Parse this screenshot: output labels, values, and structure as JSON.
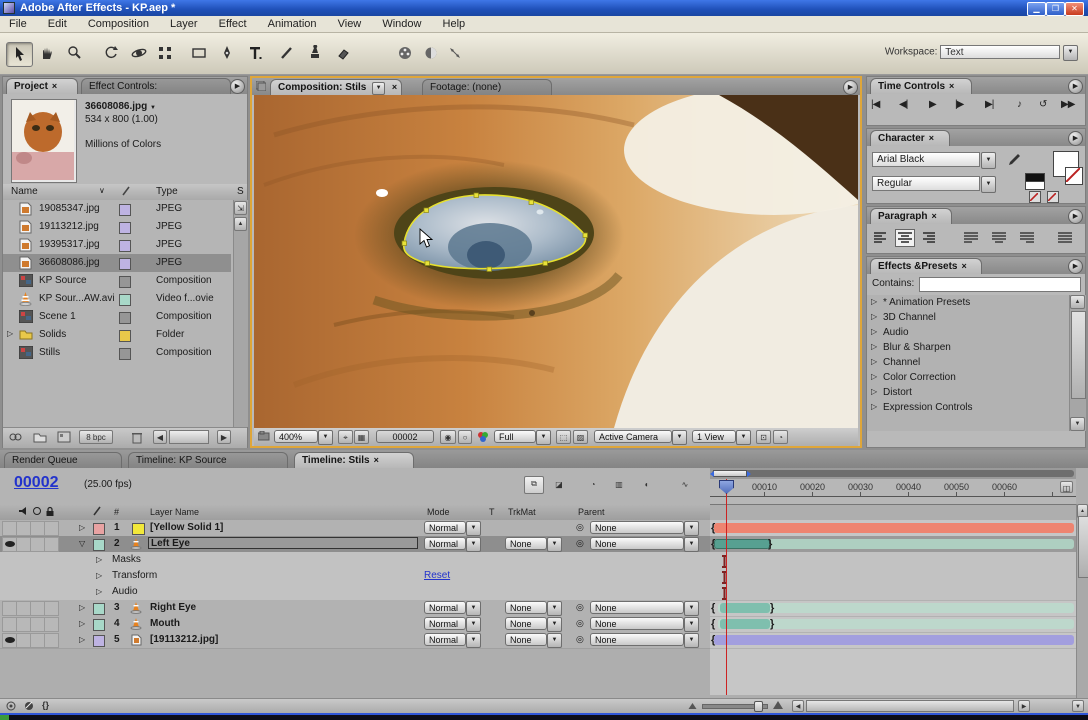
{
  "window": {
    "title": "Adobe After Effects - KP.aep *"
  },
  "menu": [
    "File",
    "Edit",
    "Composition",
    "Layer",
    "Effect",
    "Animation",
    "View",
    "Window",
    "Help"
  ],
  "toolbar": {
    "workspace_label": "Workspace:",
    "workspace_value": "Text"
  },
  "icons": {
    "dropdown": "▼",
    "close": "×",
    "panel_menu": "▶",
    "overflow": "▶",
    "twirl_closed": "▷",
    "twirl_open": "▽",
    "sort": "∨",
    "go_start": "|◀",
    "step_back": "◀|",
    "play": "▶",
    "step_fwd": "|▶",
    "go_end": "▶|",
    "audio": "♪",
    "loop": "↺",
    "ram_preview": "▶▶",
    "pickwhip": "◎",
    "scroll_left": "◀",
    "scroll_right": "▶",
    "scroll_up": "▲",
    "scroll_down": "▼",
    "zoom_out_mountain": "▲",
    "zoom_in_mountain": "▲"
  },
  "project": {
    "tab": "Project",
    "tab_effect_controls": "Effect Controls:",
    "info": {
      "filename": "36608086.jpg",
      "dimensions": "534 x 800 (1.00)",
      "colors": "Millions of Colors"
    },
    "header": {
      "name": "Name",
      "type": "Type",
      "size": "S"
    },
    "rows": [
      {
        "name": "19085347.jpg",
        "type": "JPEG"
      },
      {
        "name": "19113212.jpg",
        "type": "JPEG"
      },
      {
        "name": "19395317.jpg",
        "type": "JPEG"
      },
      {
        "name": "36608086.jpg",
        "type": "JPEG"
      },
      {
        "name": "KP Source",
        "type": "Composition"
      },
      {
        "name": "KP Sour...AW.avi",
        "type": "Video f...ovie"
      },
      {
        "name": "Scene 1",
        "type": "Composition"
      },
      {
        "name": "Solids",
        "type": "Folder"
      },
      {
        "name": "Stills",
        "type": "Composition"
      }
    ],
    "footer_bpc": "8 bpc"
  },
  "comp": {
    "tab": "Composition: Stils",
    "tab_footage": "Footage: (none)",
    "zoom": "400%",
    "frame": "00002",
    "resolution": "Full",
    "camera": "Active Camera",
    "view": "1 View"
  },
  "time_controls": {
    "title": "Time Controls"
  },
  "character": {
    "title": "Character",
    "font": "Arial Black",
    "style": "Regular"
  },
  "paragraph": {
    "title": "Paragraph"
  },
  "effects": {
    "title": "Effects &Presets",
    "contains_label": "Contains:",
    "items": [
      "* Animation Presets",
      "3D Channel",
      "Audio",
      "Blur & Sharpen",
      "Channel",
      "Color Correction",
      "Distort",
      "Expression Controls"
    ]
  },
  "timeline": {
    "tabs": {
      "render_queue": "Render Queue",
      "kp_source": "Timeline: KP Source",
      "stils": "Timeline: Stils"
    },
    "frame": "00002",
    "fps": "(25.00 fps)",
    "cols": {
      "num": "#",
      "layer_name": "Layer Name",
      "mode": "Mode",
      "t": "T",
      "trkmat": "TrkMat",
      "parent": "Parent"
    },
    "ruler": [
      "00010",
      "00020",
      "00030",
      "00040",
      "00050",
      "00060"
    ],
    "layers": [
      {
        "num": "1",
        "name": "[Yellow Solid 1]",
        "mode": "Normal",
        "parent": "None"
      },
      {
        "num": "2",
        "name": "Left Eye",
        "mode": "Normal",
        "trkmat": "None",
        "parent": "None"
      },
      {
        "num": "3",
        "name": "Right Eye",
        "mode": "Normal",
        "trkmat": "None",
        "parent": "None"
      },
      {
        "num": "4",
        "name": "Mouth",
        "mode": "Normal",
        "trkmat": "None",
        "parent": "None"
      },
      {
        "num": "5",
        "name": "[19113212.jpg]",
        "mode": "Normal",
        "trkmat": "None",
        "parent": "None"
      }
    ],
    "props": {
      "masks": "Masks",
      "transform": "Transform",
      "audio": "Audio",
      "reset": "Reset"
    }
  },
  "colors": {
    "comp_border": "#dfa639",
    "bar_salmon": "#ee8470",
    "bar_teal_dark": "#57a091",
    "bar_teal_pale": "#aecfc1",
    "bar_teal_mid": "#7fbfae",
    "bar_lavender": "#a29ede",
    "cti": "#cc2222"
  }
}
